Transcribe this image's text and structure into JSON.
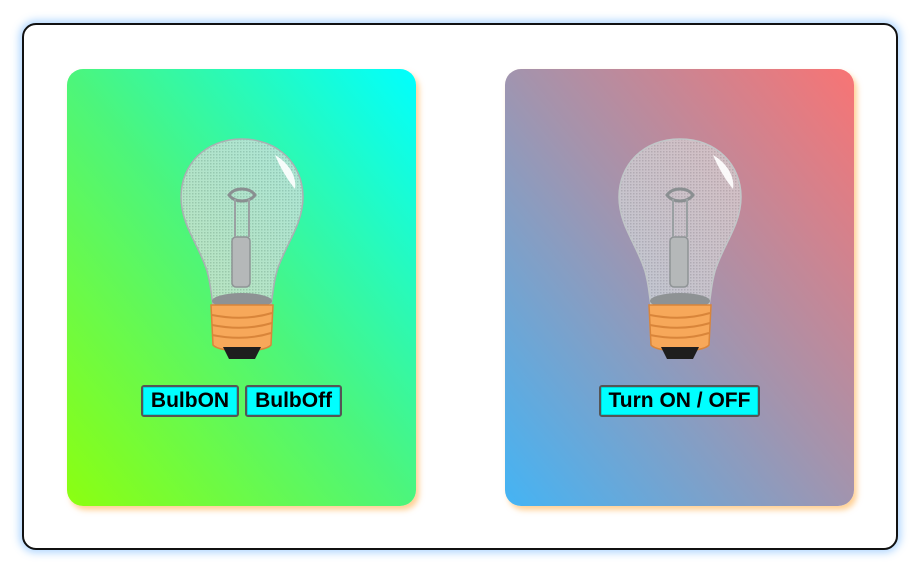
{
  "cards": [
    {
      "buttons": [
        {
          "label": "BulbON"
        },
        {
          "label": "BulbOff"
        }
      ],
      "bulb_icon": "light-bulb-off"
    },
    {
      "buttons": [
        {
          "label": "Turn ON / OFF"
        }
      ],
      "bulb_icon": "light-bulb-off"
    }
  ],
  "colors": {
    "left_card_gradient": [
      "#8cff10",
      "#00ffff"
    ],
    "right_card_gradient": [
      "#44b4f4",
      "#f87474"
    ],
    "button_background": "#00ffff",
    "frame_glow": "#5aaaff"
  }
}
